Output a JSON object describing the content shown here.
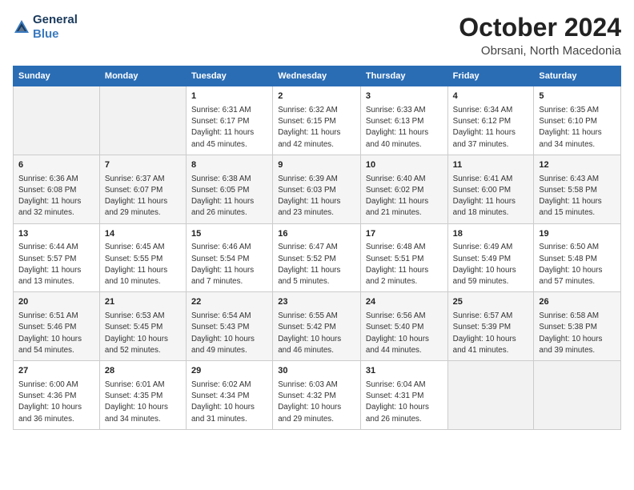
{
  "header": {
    "logo_line1": "General",
    "logo_line2": "Blue",
    "month_title": "October 2024",
    "location": "Obrsani, North Macedonia"
  },
  "days_of_week": [
    "Sunday",
    "Monday",
    "Tuesday",
    "Wednesday",
    "Thursday",
    "Friday",
    "Saturday"
  ],
  "weeks": [
    [
      {
        "day": "",
        "info": ""
      },
      {
        "day": "",
        "info": ""
      },
      {
        "day": "1",
        "info": "Sunrise: 6:31 AM\nSunset: 6:17 PM\nDaylight: 11 hours and 45 minutes."
      },
      {
        "day": "2",
        "info": "Sunrise: 6:32 AM\nSunset: 6:15 PM\nDaylight: 11 hours and 42 minutes."
      },
      {
        "day": "3",
        "info": "Sunrise: 6:33 AM\nSunset: 6:13 PM\nDaylight: 11 hours and 40 minutes."
      },
      {
        "day": "4",
        "info": "Sunrise: 6:34 AM\nSunset: 6:12 PM\nDaylight: 11 hours and 37 minutes."
      },
      {
        "day": "5",
        "info": "Sunrise: 6:35 AM\nSunset: 6:10 PM\nDaylight: 11 hours and 34 minutes."
      }
    ],
    [
      {
        "day": "6",
        "info": "Sunrise: 6:36 AM\nSunset: 6:08 PM\nDaylight: 11 hours and 32 minutes."
      },
      {
        "day": "7",
        "info": "Sunrise: 6:37 AM\nSunset: 6:07 PM\nDaylight: 11 hours and 29 minutes."
      },
      {
        "day": "8",
        "info": "Sunrise: 6:38 AM\nSunset: 6:05 PM\nDaylight: 11 hours and 26 minutes."
      },
      {
        "day": "9",
        "info": "Sunrise: 6:39 AM\nSunset: 6:03 PM\nDaylight: 11 hours and 23 minutes."
      },
      {
        "day": "10",
        "info": "Sunrise: 6:40 AM\nSunset: 6:02 PM\nDaylight: 11 hours and 21 minutes."
      },
      {
        "day": "11",
        "info": "Sunrise: 6:41 AM\nSunset: 6:00 PM\nDaylight: 11 hours and 18 minutes."
      },
      {
        "day": "12",
        "info": "Sunrise: 6:43 AM\nSunset: 5:58 PM\nDaylight: 11 hours and 15 minutes."
      }
    ],
    [
      {
        "day": "13",
        "info": "Sunrise: 6:44 AM\nSunset: 5:57 PM\nDaylight: 11 hours and 13 minutes."
      },
      {
        "day": "14",
        "info": "Sunrise: 6:45 AM\nSunset: 5:55 PM\nDaylight: 11 hours and 10 minutes."
      },
      {
        "day": "15",
        "info": "Sunrise: 6:46 AM\nSunset: 5:54 PM\nDaylight: 11 hours and 7 minutes."
      },
      {
        "day": "16",
        "info": "Sunrise: 6:47 AM\nSunset: 5:52 PM\nDaylight: 11 hours and 5 minutes."
      },
      {
        "day": "17",
        "info": "Sunrise: 6:48 AM\nSunset: 5:51 PM\nDaylight: 11 hours and 2 minutes."
      },
      {
        "day": "18",
        "info": "Sunrise: 6:49 AM\nSunset: 5:49 PM\nDaylight: 10 hours and 59 minutes."
      },
      {
        "day": "19",
        "info": "Sunrise: 6:50 AM\nSunset: 5:48 PM\nDaylight: 10 hours and 57 minutes."
      }
    ],
    [
      {
        "day": "20",
        "info": "Sunrise: 6:51 AM\nSunset: 5:46 PM\nDaylight: 10 hours and 54 minutes."
      },
      {
        "day": "21",
        "info": "Sunrise: 6:53 AM\nSunset: 5:45 PM\nDaylight: 10 hours and 52 minutes."
      },
      {
        "day": "22",
        "info": "Sunrise: 6:54 AM\nSunset: 5:43 PM\nDaylight: 10 hours and 49 minutes."
      },
      {
        "day": "23",
        "info": "Sunrise: 6:55 AM\nSunset: 5:42 PM\nDaylight: 10 hours and 46 minutes."
      },
      {
        "day": "24",
        "info": "Sunrise: 6:56 AM\nSunset: 5:40 PM\nDaylight: 10 hours and 44 minutes."
      },
      {
        "day": "25",
        "info": "Sunrise: 6:57 AM\nSunset: 5:39 PM\nDaylight: 10 hours and 41 minutes."
      },
      {
        "day": "26",
        "info": "Sunrise: 6:58 AM\nSunset: 5:38 PM\nDaylight: 10 hours and 39 minutes."
      }
    ],
    [
      {
        "day": "27",
        "info": "Sunrise: 6:00 AM\nSunset: 4:36 PM\nDaylight: 10 hours and 36 minutes."
      },
      {
        "day": "28",
        "info": "Sunrise: 6:01 AM\nSunset: 4:35 PM\nDaylight: 10 hours and 34 minutes."
      },
      {
        "day": "29",
        "info": "Sunrise: 6:02 AM\nSunset: 4:34 PM\nDaylight: 10 hours and 31 minutes."
      },
      {
        "day": "30",
        "info": "Sunrise: 6:03 AM\nSunset: 4:32 PM\nDaylight: 10 hours and 29 minutes."
      },
      {
        "day": "31",
        "info": "Sunrise: 6:04 AM\nSunset: 4:31 PM\nDaylight: 10 hours and 26 minutes."
      },
      {
        "day": "",
        "info": ""
      },
      {
        "day": "",
        "info": ""
      }
    ]
  ]
}
